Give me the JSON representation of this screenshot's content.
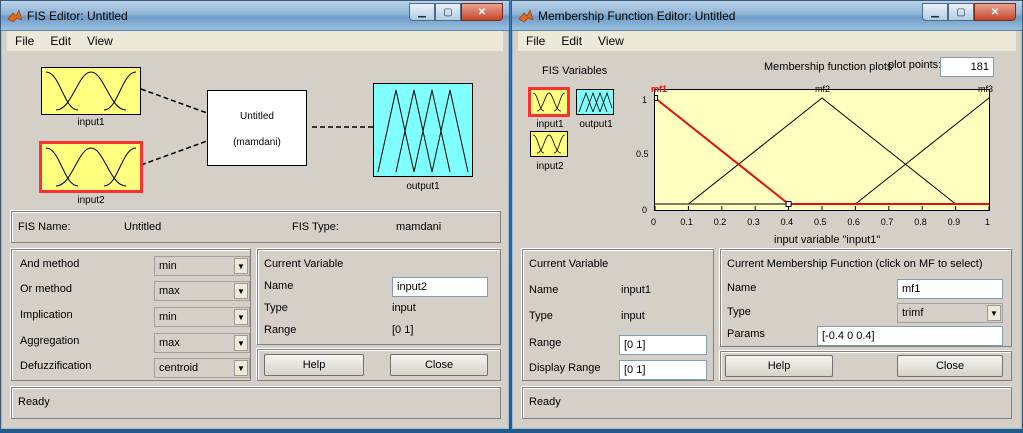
{
  "fis_window": {
    "title": "FIS Editor: Untitled",
    "menu": [
      "File",
      "Edit",
      "View"
    ],
    "input1_label": "input1",
    "input2_label": "input2",
    "output1_label": "output1",
    "system_name": "Untitled",
    "system_type": "(mamdani)",
    "fis_name_label": "FIS Name:",
    "fis_name_value": "Untitled",
    "fis_type_label": "FIS Type:",
    "fis_type_value": "mamdani",
    "methods": [
      {
        "label": "And method",
        "value": "min"
      },
      {
        "label": "Or method",
        "value": "max"
      },
      {
        "label": "Implication",
        "value": "min"
      },
      {
        "label": "Aggregation",
        "value": "max"
      },
      {
        "label": "Defuzzification",
        "value": "centroid"
      }
    ],
    "current_variable": {
      "heading": "Current Variable",
      "name_label": "Name",
      "name_value": "input2",
      "type_label": "Type",
      "type_value": "input",
      "range_label": "Range",
      "range_value": "[0 1]"
    },
    "help_button": "Help",
    "close_button": "Close",
    "status": "Ready"
  },
  "mf_window": {
    "title": "Membership Function Editor: Untitled",
    "menu": [
      "File",
      "Edit",
      "View"
    ],
    "fis_variables_heading": "FIS Variables",
    "input1_label": "input1",
    "output1_label": "output1",
    "input2_label": "input2",
    "plots_heading": "Membership function plots",
    "plot_points_label": "plot points:",
    "plot_points_value": "181",
    "xlabel": "input variable \"input1\"",
    "mf_names": [
      "mf1",
      "mf2",
      "mf3"
    ],
    "x_ticks": [
      "0",
      "0.1",
      "0.2",
      "0.3",
      "0.4",
      "0.5",
      "0.6",
      "0.7",
      "0.8",
      "0.9",
      "1"
    ],
    "y_ticks": [
      "0",
      "0.5",
      "1"
    ],
    "current_variable": {
      "heading": "Current Variable",
      "name_label": "Name",
      "name_value": "input1",
      "type_label": "Type",
      "type_value": "input",
      "range_label": "Range",
      "range_value": "[0 1]",
      "display_range_label": "Display Range",
      "display_range_value": "[0 1]"
    },
    "current_mf": {
      "heading": "Current Membership Function (click on MF to select)",
      "name_label": "Name",
      "name_value": "mf1",
      "type_label": "Type",
      "type_value": "trimf",
      "params_label": "Params",
      "params_value": "[-0.4 0 0.4]"
    },
    "help_button": "Help",
    "close_button": "Close",
    "status": "Ready"
  },
  "colors": {
    "input_fill": "#ffff80",
    "output_fill": "#80ffff",
    "selected": "#ff3030",
    "plot_bg": "#ffffc0"
  },
  "chart_data": {
    "type": "line",
    "xlabel": "input variable \"input1\"",
    "xlim": [
      0,
      1
    ],
    "ylim": [
      0,
      1
    ],
    "series": [
      {
        "name": "mf1",
        "x": [
          -0.4,
          0,
          0.4,
          1
        ],
        "y": [
          0,
          1,
          0,
          0
        ],
        "selected": true
      },
      {
        "name": "mf2",
        "x": [
          0,
          0.1,
          0.5,
          0.9,
          1
        ],
        "y": [
          0,
          0,
          1,
          0,
          0
        ]
      },
      {
        "name": "mf3",
        "x": [
          0,
          0.6,
          1,
          1.4
        ],
        "y": [
          0,
          0,
          1,
          0
        ]
      }
    ]
  }
}
